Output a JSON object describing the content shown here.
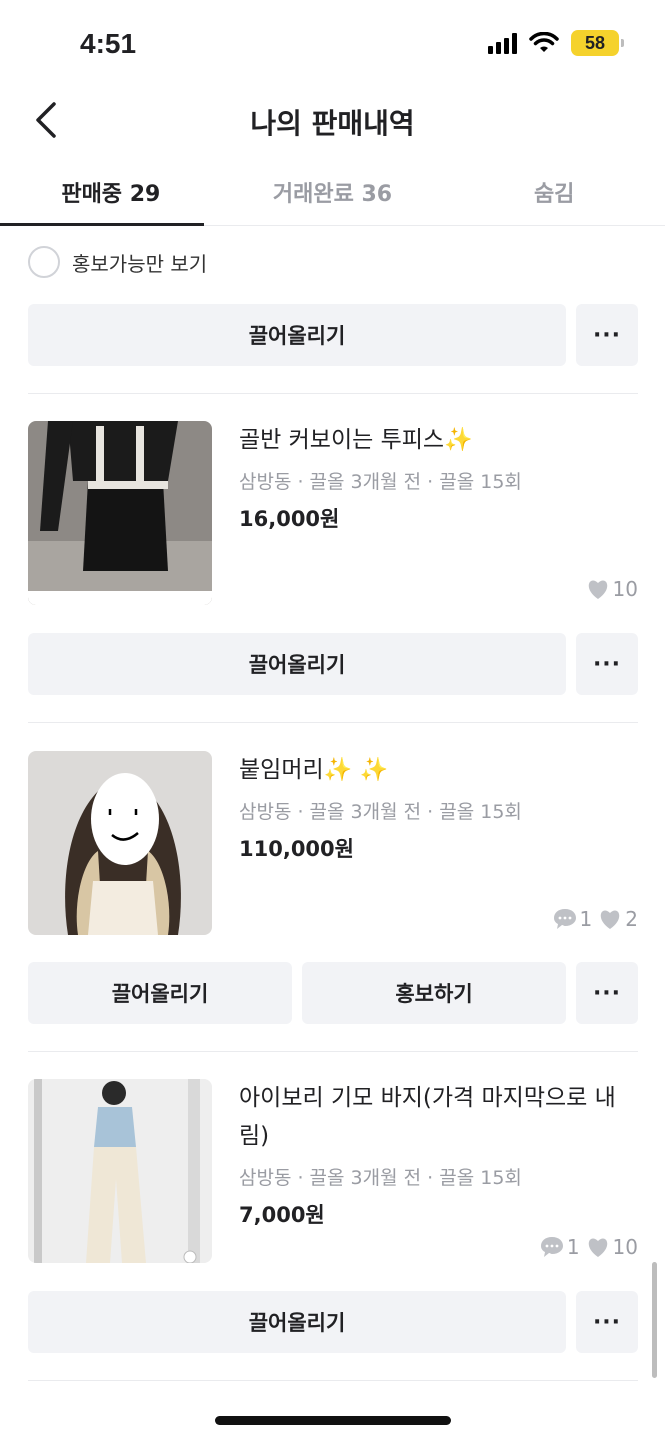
{
  "status": {
    "time": "4:51",
    "battery": "58"
  },
  "header": {
    "title": "나의 판매내역",
    "back_icon": "chevron-left-icon"
  },
  "tabs": [
    {
      "label": "판매중 29",
      "active": true
    },
    {
      "label": "거래완료 36",
      "active": false
    },
    {
      "label": "숨김",
      "active": false
    }
  ],
  "filter": {
    "label": "홍보가능만 보기"
  },
  "actions": {
    "bump": "끌어올리기",
    "promote": "홍보하기",
    "more": "···"
  },
  "items": [
    {
      "title": "골반 커보이는 투피스",
      "sparkles": "✨",
      "meta": "삼방동 · 끌올 3개월 전 · 끌올 15회",
      "price": "16,000원",
      "likes": "10",
      "chats": ""
    },
    {
      "title": "붙임머리",
      "sparkles": "✨ ✨",
      "meta": "삼방동 · 끌올 3개월 전 · 끌올 15회",
      "price": "110,000원",
      "likes": "2",
      "chats": "1"
    },
    {
      "title": "아이보리 기모 바지(가격 마지막으로 내림)",
      "sparkles": "",
      "meta": "삼방동 · 끌올 3개월 전 · 끌올 15회",
      "price": "7,000원",
      "likes": "10",
      "chats": "1"
    }
  ],
  "colors": {
    "accent": "#212124",
    "muted": "#9a9ca3",
    "button_bg": "#f2f3f6",
    "battery": "#f5d22c"
  }
}
